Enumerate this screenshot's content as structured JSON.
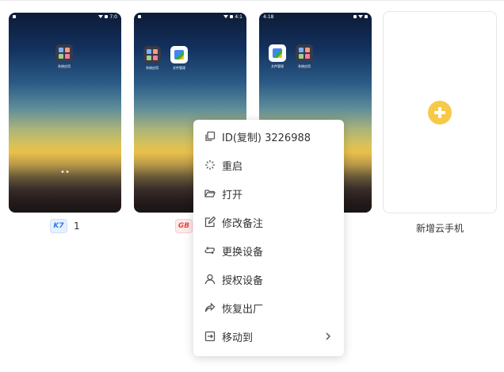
{
  "devices": [
    {
      "time": "7:0",
      "apps": [
        {
          "label": "系统应用"
        }
      ],
      "badge": "K7",
      "name": "1"
    },
    {
      "time": "4:1",
      "apps": [
        {
          "label": "系统应用"
        },
        {
          "label": "文件管理"
        }
      ],
      "badge": "GB",
      "name": ""
    },
    {
      "time": "4:18",
      "apps": [
        {
          "label": "文件管理"
        },
        {
          "label": "系统应用"
        }
      ],
      "badge": "",
      "name": ""
    }
  ],
  "add_card": {
    "label": "新增云手机"
  },
  "context_menu": {
    "items": [
      {
        "label": "ID(复制) 3226988",
        "icon": "copy-icon"
      },
      {
        "label": "重启",
        "icon": "loading-icon"
      },
      {
        "label": "打开",
        "icon": "folder-open-icon"
      },
      {
        "label": "修改备注",
        "icon": "edit-icon"
      },
      {
        "label": "更换设备",
        "icon": "swap-icon"
      },
      {
        "label": "授权设备",
        "icon": "user-icon"
      },
      {
        "label": "恢复出厂",
        "icon": "share-arrow-icon"
      },
      {
        "label": "移动到",
        "icon": "move-to-icon",
        "has_submenu": true
      }
    ]
  },
  "colors": {
    "accent": "#f7c948",
    "badge_k7": "#2f7ae5",
    "badge_gb": "#e54848"
  }
}
